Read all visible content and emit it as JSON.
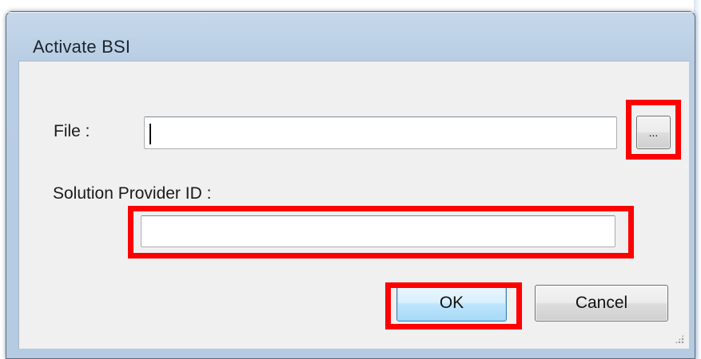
{
  "window": {
    "title": "Activate BSI"
  },
  "form": {
    "file_label": "File :",
    "file_value": "",
    "browse_label": "...",
    "provider_label": "Solution Provider ID :",
    "provider_value": ""
  },
  "buttons": {
    "ok_label": "OK",
    "cancel_label": "Cancel"
  },
  "colors": {
    "highlight": "#ff0000",
    "title_bar": "#b9cee4",
    "client_background": "#f0f0f0"
  },
  "icons": {
    "size_grip": "resize-grip-icon"
  }
}
